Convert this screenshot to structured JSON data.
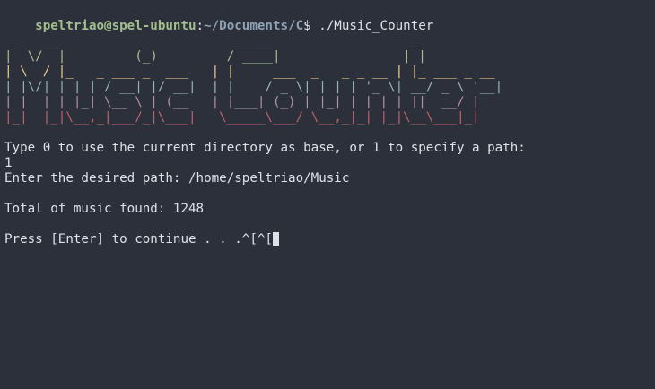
{
  "prompt": {
    "user_host": "speltriao@spel-ubuntu",
    "separator": ":",
    "path": "~/Documents/C",
    "symbol": "$",
    "command": " ./Music_Counter"
  },
  "ascii_art": [
    " __  __           _           _____                  _",
    "|  \\/  |         (_)         / ____|                | |",
    "| \\  / |_   _ ___ _  ___   | |     ___  _   _ _ __ | |_ ___ _ __",
    "| |\\/| | | | / __| |/ __|  | |    / _ \\| | | | '_ \\| __/ _ \\ '__|",
    "| |  | | |_| \\__ \\ | (__   | |___| (_) | |_| | | | | ||  __/ |",
    "|_|  |_|\\__,_|___/_|\\___|   \\_____\\___/ \\__,_|_| |_|\\__\\___|_|"
  ],
  "output": {
    "line1": "Type 0 to use the current directory as base, or 1 to specify a path:",
    "line2": "1",
    "line3": "Enter the desired path: /home/speltriao/Music",
    "line4": "Total of music found: 1248",
    "line5": "Press [Enter] to continue . . .^[^["
  },
  "colors": {
    "background": "#2b303b",
    "foreground": "#dfe1e8",
    "prompt_user": "#a3be8c",
    "prompt_path": "#8fa1b3",
    "art_row_colors": [
      "#8fa1b3",
      "#a3be8c",
      "#ebcb8b",
      "#96b5b4",
      "#b48ead",
      "#bf616a"
    ]
  }
}
